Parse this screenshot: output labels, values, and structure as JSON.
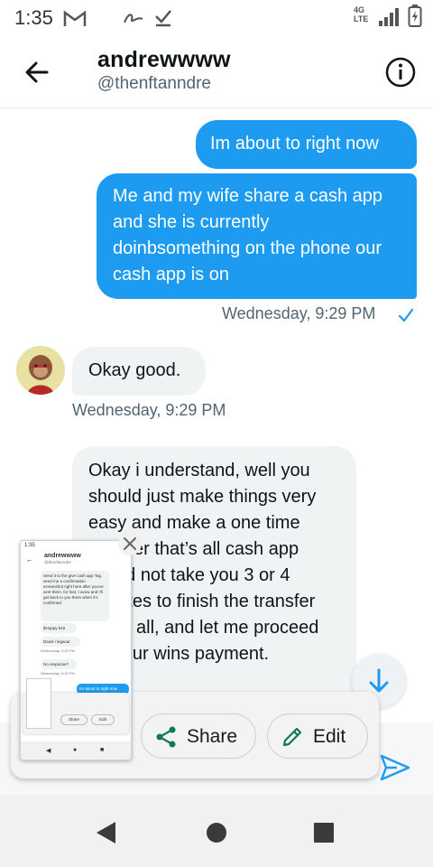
{
  "status_bar": {
    "time": "1:35",
    "network": "4G LTE",
    "icons": [
      "gmail-icon",
      "signature-icon",
      "download-done-icon",
      "signal-icon",
      "battery-charging-icon"
    ]
  },
  "header": {
    "title": "andrewwww",
    "handle": "@thenftanndre",
    "back_icon": "arrow-back-icon",
    "info_icon": "info-icon"
  },
  "messages": [
    {
      "direction": "sent",
      "text": "Im about to right now"
    },
    {
      "direction": "sent",
      "text": "Me and my wife share a cash app and she is currently doinbsomething on the phone our cash app is on"
    },
    {
      "direction": "sent_timestamp",
      "text": "Wednesday, 9:29 PM"
    },
    {
      "direction": "received",
      "text": "Okay good."
    },
    {
      "direction": "received_timestamp",
      "text": "Wednesday, 9:29 PM"
    },
    {
      "direction": "received",
      "text": "Okay i understand, well you should just make things very easy and make a one time transfer that’s all cash app would not take you 3 or 4 minutes to finish the transfer that’s all, and let me proceed on your wins payment."
    }
  ],
  "screenshot_preview": {
    "share_label": "Share",
    "edit_label": "Edit",
    "thumb": {
      "time": "1:35",
      "title": "andrewwww",
      "handle": "@thenftanndre",
      "msg1": "Send it to the give cash app Tag. send me a confirmation screenshot right here after you've sent them. for fast, I avow and I'll get back to you there when it's confirmed.",
      "msg2": "$Hoppy 916",
      "ts1": "Wednesday, 9:00 PM",
      "msg3": "David i legacar",
      "ts2": "Wednesday, 9:20 PM",
      "msg4": "No response?",
      "ts3": "Wednesday, 9:27 PM",
      "msg5": "Im about to right now",
      "msg6": "Me and my wife share a cash app and she's currently",
      "share": "Share",
      "edit": "Edit"
    }
  },
  "colors": {
    "accent": "#1d9bf0",
    "received_bubble": "#eff3f4",
    "secondary_text": "#536471"
  }
}
